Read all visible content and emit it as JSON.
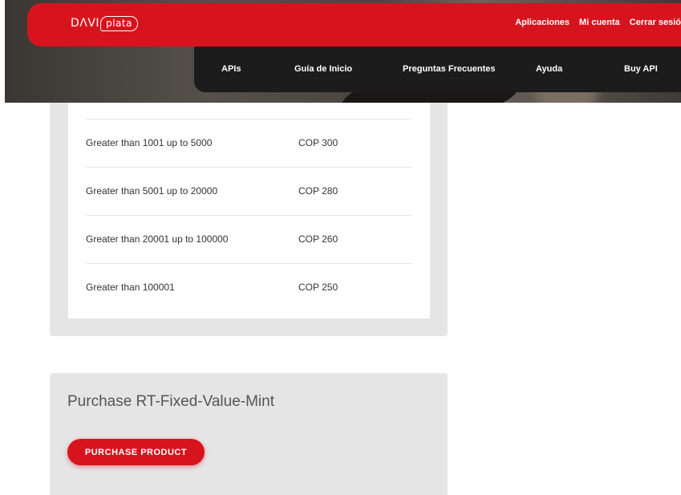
{
  "header": {
    "logo_left": "DΛVI",
    "logo_box": "plata",
    "top_nav": [
      "Aplicaciones",
      "Mi cuenta",
      "Cerrar sesió"
    ],
    "sub_nav": [
      "APIs",
      "Guía de Inicio",
      "Preguntas Frecuentes",
      "Ayuda",
      "Buy API"
    ]
  },
  "pricing": {
    "rows": [
      {
        "range": "Greater than 1001 up to 5000",
        "price": "COP 300"
      },
      {
        "range": "Greater than 5001 up to 20000",
        "price": "COP 280"
      },
      {
        "range": "Greater than 20001 up to 100000",
        "price": "COP 260"
      },
      {
        "range": "Greater than 100001",
        "price": "COP 250"
      }
    ]
  },
  "purchase": {
    "title": "Purchase RT-Fixed-Value-Mint",
    "button_label": "PURCHASE PRODUCT"
  },
  "colors": {
    "brand_red": "#d7141e",
    "nav_dark": "#1c1c1c",
    "card_gray": "#e5e5e5"
  }
}
